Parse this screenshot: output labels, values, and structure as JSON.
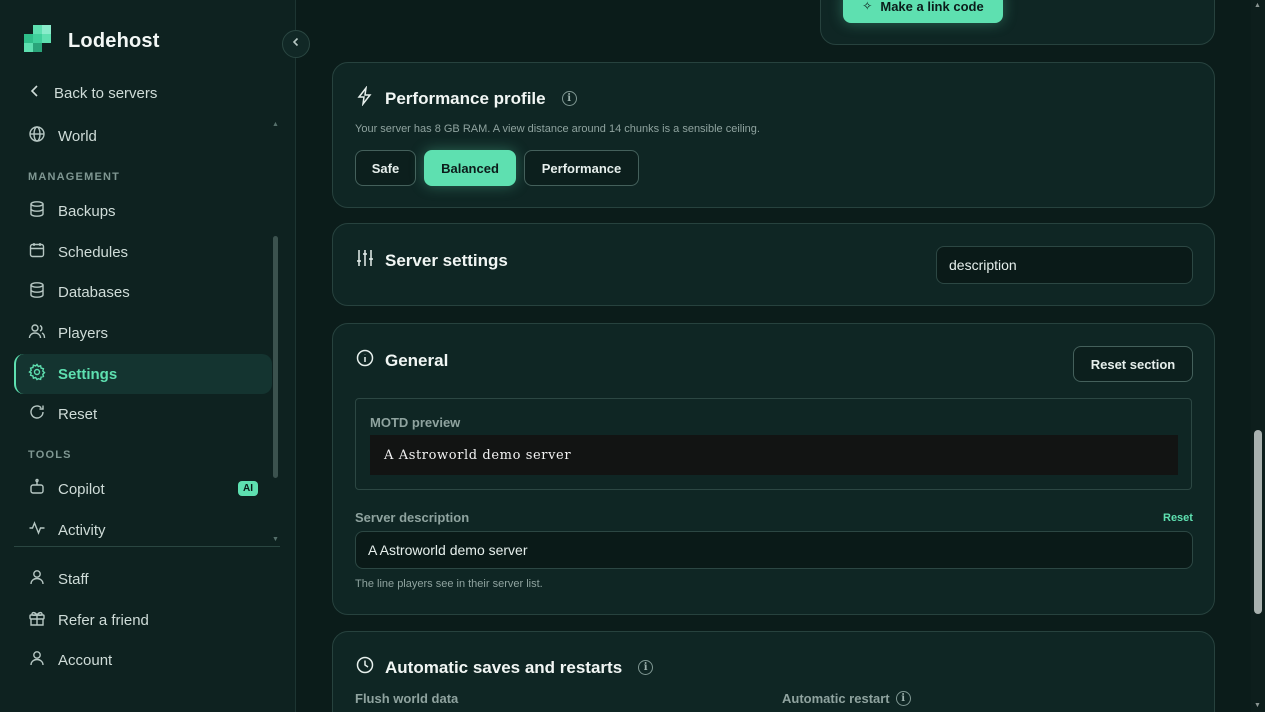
{
  "brand": {
    "name": "Lodehost"
  },
  "sidebar": {
    "back_label": "Back to servers",
    "world_label": "World",
    "management_label": "MANAGEMENT",
    "management_items": [
      {
        "label": "Backups",
        "icon": "database-icon"
      },
      {
        "label": "Schedules",
        "icon": "calendar-icon"
      },
      {
        "label": "Databases",
        "icon": "database-icon"
      },
      {
        "label": "Players",
        "icon": "users-icon"
      },
      {
        "label": "Settings",
        "icon": "gear-icon",
        "active": true
      },
      {
        "label": "Reset",
        "icon": "refresh-icon"
      }
    ],
    "tools_label": "TOOLS",
    "tools_items": [
      {
        "label": "Copilot",
        "icon": "bot-icon",
        "badge": "AI"
      },
      {
        "label": "Activity",
        "icon": "activity-icon"
      }
    ],
    "bottom_items": [
      {
        "label": "Staff",
        "icon": "user-icon"
      },
      {
        "label": "Refer a friend",
        "icon": "gift-icon"
      },
      {
        "label": "Account",
        "icon": "user-icon"
      }
    ]
  },
  "top_card": {
    "link_button": "Make a link code"
  },
  "performance": {
    "title": "Performance profile",
    "info": "i",
    "description": "Your server has 8 GB RAM. A view distance around 14 chunks is a sensible ceiling.",
    "options": [
      "Safe",
      "Balanced",
      "Performance"
    ],
    "selected": "Balanced"
  },
  "server_settings": {
    "title": "Server settings",
    "search_value": "description"
  },
  "general": {
    "title": "General",
    "reset_section": "Reset section",
    "motd_label": "MOTD preview",
    "motd_preview": "A Astroworld demo server",
    "description_label": "Server description",
    "description_reset": "Reset",
    "description_value": "A Astroworld demo server",
    "description_help": "The line players see in their server list."
  },
  "autosave": {
    "title": "Automatic saves and restarts",
    "info": "i",
    "flush_label": "Flush world data",
    "restart_label": "Automatic restart",
    "restart_info": "i"
  },
  "colors": {
    "accent": "#5ee0b0",
    "background": "#0b1c1a",
    "card": "#0f2624"
  }
}
